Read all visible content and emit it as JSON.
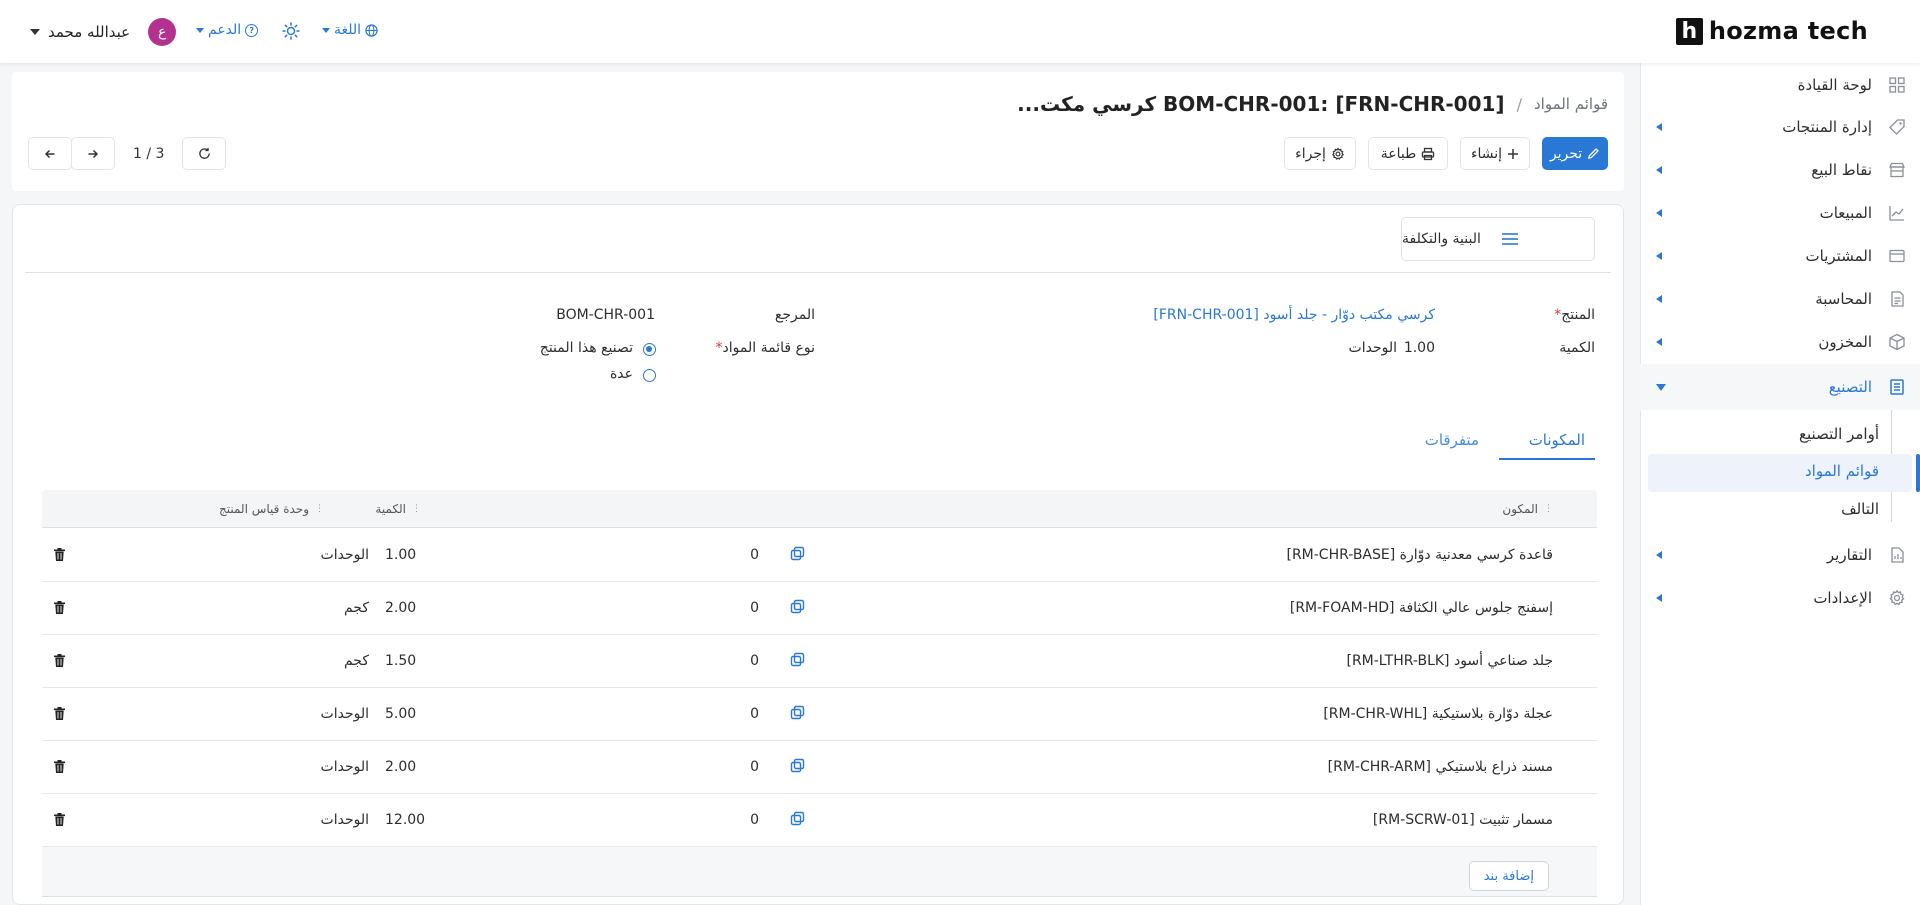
{
  "topbar": {
    "user_name": "عبدالله محمد",
    "user_initial": "ع",
    "support_label": "الدعم",
    "language_label": "اللغة",
    "brand_letter": "h",
    "brand_name": "hozma tech"
  },
  "sidebar": {
    "items": [
      {
        "label": "لوحة القيادة",
        "icon": "grid-icon"
      },
      {
        "label": "إدارة المنتجات",
        "icon": "tag-icon"
      },
      {
        "label": "نقاط البيع",
        "icon": "store-icon"
      },
      {
        "label": "المبيعات",
        "icon": "chart-line-icon"
      },
      {
        "label": "المشتريات",
        "icon": "wallet-icon"
      },
      {
        "label": "المحاسبة",
        "icon": "ledger-icon"
      },
      {
        "label": "المخزون",
        "icon": "box-icon"
      },
      {
        "label": "التصنيع",
        "icon": "document-icon"
      },
      {
        "label": "التقارير",
        "icon": "report-icon"
      },
      {
        "label": "الإعدادات",
        "icon": "gear-icon"
      }
    ],
    "sub_items": [
      "أوامر التصنيع",
      "قوائم المواد",
      "التالف"
    ]
  },
  "header": {
    "breadcrumb_parent": "قوائم المواد",
    "breadcrumb_sep": "/",
    "title": "BOM-CHR-001: [FRN-CHR-001] كرسي مكت...",
    "edit_label": "تحرير",
    "create_label": "إنشاء",
    "print_label": "طباعة",
    "action_label": "إجراء",
    "pager_text": "1 / 3"
  },
  "form": {
    "smart_button_label": "البنية والتكلفة",
    "product_label": "المنتج",
    "product_value": "[FRN-CHR-001] كرسي مكتب دوّار - جلد أسود",
    "quantity_label": "الكمية",
    "quantity_value": "1.00",
    "quantity_uom": "الوحدات",
    "reference_label": "المرجع",
    "reference_value": "BOM-CHR-001",
    "bom_type_label": "نوع قائمة المواد",
    "bom_type_options": [
      "تصنيع هذا المنتج",
      "عدة"
    ]
  },
  "tabs": [
    "المكونات",
    "متفرقات"
  ],
  "table": {
    "headers": {
      "component": "المكون",
      "quantity": "الكمية",
      "uom": "وحدة قياس المنتج"
    },
    "rows": [
      {
        "component": "[RM-CHR-BASE] قاعدة كرسي معدنية دوّارة",
        "zero": "0",
        "qty": "1.00",
        "uom": "الوحدات"
      },
      {
        "component": "[RM-FOAM-HD] إسفنج جلوس عالي الكثافة",
        "zero": "0",
        "qty": "2.00",
        "uom": "كجم"
      },
      {
        "component": "[RM-LTHR-BLK] جلد صناعي أسود",
        "zero": "0",
        "qty": "1.50",
        "uom": "كجم"
      },
      {
        "component": "[RM-CHR-WHL] عجلة دوّارة بلاستيكية",
        "zero": "0",
        "qty": "5.00",
        "uom": "الوحدات"
      },
      {
        "component": "[RM-CHR-ARM] مسند ذراع بلاستيكي",
        "zero": "0",
        "qty": "2.00",
        "uom": "الوحدات"
      },
      {
        "component": "[RM-SCRW-01] مسمار تثبيت",
        "zero": "0",
        "qty": "12.00",
        "uom": "الوحدات"
      }
    ],
    "add_line_label": "إضافة بند"
  },
  "colors": {
    "accent": "#2a78d6",
    "avatar": "#b5318f"
  }
}
